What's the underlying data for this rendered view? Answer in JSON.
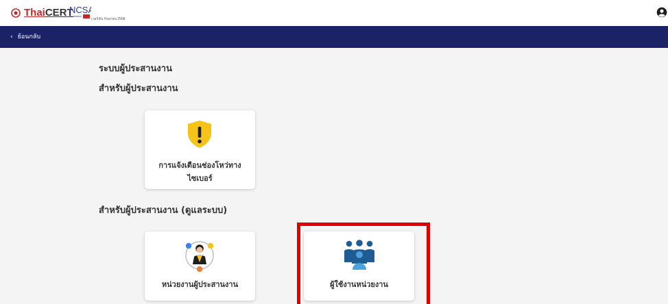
{
  "header": {
    "brand_thai": "Thai",
    "brand_cert": "CERT",
    "ncsa_logo_text": "NCSA",
    "ncsa_subtitle": "เวอร์ชัน กันยายน 2568",
    "user_icon": "user-circle-icon"
  },
  "navbar": {
    "back_label": "ย้อนกลับ",
    "background": "#1b2266"
  },
  "page": {
    "title": "ระบบผู้ประสานงาน",
    "section1_title": "สำหรับผู้ประสานงาน",
    "section2_title": "สำหรับผู้ประสานงาน (ดูแลระบบ)"
  },
  "cards": {
    "alert": {
      "label": "การแจ้งเตือนช่องโหว่ทางไซเบอร์",
      "icon": "warning-shield-icon"
    },
    "agency_coordinator": {
      "label": "หน่วยงานผู้ประสานงาน",
      "icon": "coordinator-person-icon"
    },
    "agency_users": {
      "label": "ผู้ใช้งานหน่วยงาน",
      "icon": "group-users-icon"
    }
  },
  "colors": {
    "accent_yellow": "#f6c418",
    "users_blue": "#1f5c93",
    "highlight_red": "#e00000"
  }
}
